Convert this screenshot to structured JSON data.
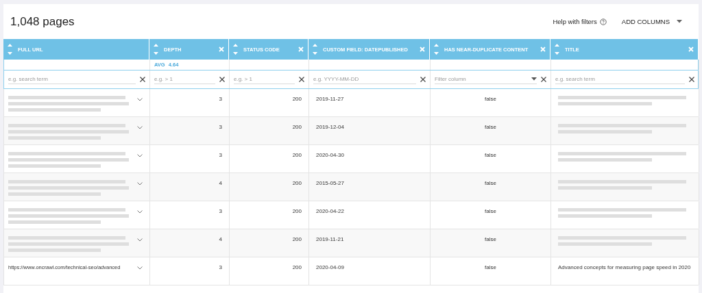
{
  "page_title": "1,048 pages",
  "help_link": "Help with filters",
  "add_columns": "ADD COLUMNS",
  "columns": [
    {
      "label": "FULL URL",
      "removable": false,
      "filter": {
        "kind": "text",
        "placeholder": "e.g. search term"
      }
    },
    {
      "label": "DEPTH",
      "removable": true,
      "avg": {
        "label": "AVG",
        "value": "4.64"
      },
      "filter": {
        "kind": "text",
        "placeholder": "e.g. > 1"
      }
    },
    {
      "label": "STATUS CODE",
      "removable": true,
      "filter": {
        "kind": "text",
        "placeholder": "e.g. > 1"
      }
    },
    {
      "label": "CUSTOM FIELD: DATEPUBLISHED",
      "removable": true,
      "filter": {
        "kind": "text",
        "placeholder": "e.g. YYYY-MM-DD"
      }
    },
    {
      "label": "HAS NEAR-DUPLICATE CONTENT",
      "removable": true,
      "filter": {
        "kind": "select",
        "placeholder": "Filter column"
      }
    },
    {
      "label": "TITLE",
      "removable": true,
      "filter": {
        "kind": "text",
        "placeholder": "e.g. search term"
      }
    }
  ],
  "rows": [
    {
      "url_redacted": true,
      "depth": "3",
      "status": "200",
      "date": "2019-11-27",
      "near_duplicate": "false",
      "title_redacted": true
    },
    {
      "url_redacted": true,
      "depth": "3",
      "status": "200",
      "date": "2019-12-04",
      "near_duplicate": "false",
      "title_redacted": true
    },
    {
      "url_redacted": true,
      "depth": "3",
      "status": "200",
      "date": "2020-04-30",
      "near_duplicate": "false",
      "title_redacted": true
    },
    {
      "url_redacted": true,
      "depth": "4",
      "status": "200",
      "date": "2015-05-27",
      "near_duplicate": "false",
      "title_redacted": true
    },
    {
      "url_redacted": true,
      "depth": "3",
      "status": "200",
      "date": "2020-04-22",
      "near_duplicate": "false",
      "title_redacted": true
    },
    {
      "url_redacted": true,
      "depth": "4",
      "status": "200",
      "date": "2019-11-21",
      "near_duplicate": "false",
      "title_redacted": true
    },
    {
      "url_redacted": false,
      "url": "https://www.oncrawl.com/technical-seo/advanced",
      "depth": "3",
      "status": "200",
      "date": "2020-04-09",
      "near_duplicate": "false",
      "title_redacted": false,
      "title": "Advanced concepts for measuring page speed in 2020"
    }
  ]
}
